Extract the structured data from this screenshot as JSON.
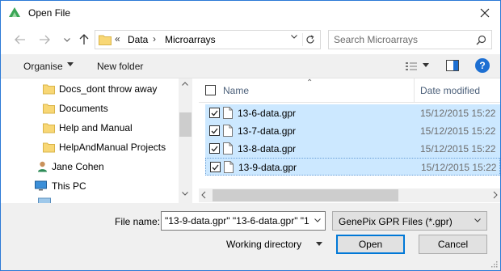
{
  "window": {
    "title": "Open File"
  },
  "address": {
    "overflow": "«",
    "crumbs": [
      "Data",
      "Microarrays"
    ],
    "separator": "›"
  },
  "search": {
    "placeholder": "Search Microarrays"
  },
  "toolbar": {
    "organise_label": "Organise",
    "new_folder_label": "New folder",
    "help_label": "?"
  },
  "nav_pane": {
    "items": [
      {
        "label": "Docs_dont throw away",
        "icon": "folder-icon"
      },
      {
        "label": "Documents",
        "icon": "folder-icon"
      },
      {
        "label": "Help and Manual",
        "icon": "folder-icon"
      },
      {
        "label": "HelpAndManual Projects",
        "icon": "folder-icon"
      },
      {
        "label": "Jane Cohen",
        "icon": "user-icon"
      },
      {
        "label": "This PC",
        "icon": "computer-icon"
      }
    ]
  },
  "file_list": {
    "columns": {
      "name": "Name",
      "date_modified": "Date modified"
    },
    "rows": [
      {
        "name": "13-6-data.gpr",
        "date": "15/12/2015 15:22",
        "checked": true
      },
      {
        "name": "13-7-data.gpr",
        "date": "15/12/2015 15:22",
        "checked": true
      },
      {
        "name": "13-8-data.gpr",
        "date": "15/12/2015 15:22",
        "checked": true
      },
      {
        "name": "13-9-data.gpr",
        "date": "15/12/2015 15:22",
        "checked": true
      }
    ]
  },
  "bottom": {
    "file_name_label": "File name:",
    "file_name_value": "\"13-9-data.gpr\" \"13-6-data.gpr\" \"1",
    "filter_label": "GenePix GPR Files (*.gpr)",
    "working_directory_label": "Working directory",
    "open_label": "Open",
    "cancel_label": "Cancel"
  },
  "colors": {
    "selection": "#cce8ff",
    "accent": "#0078d7",
    "folder": "#f8d775"
  }
}
